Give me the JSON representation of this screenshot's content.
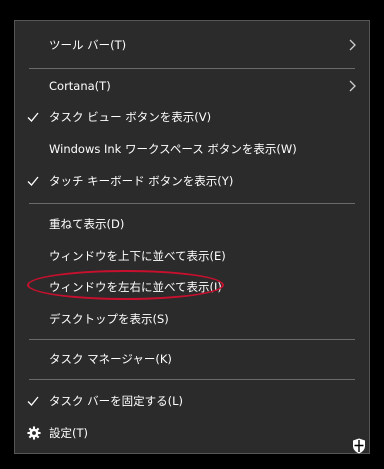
{
  "menu": {
    "items": [
      {
        "label": "ツール バー(T)",
        "checked": false,
        "submenu": true,
        "icon": null
      },
      {
        "label": "Cortana(T)",
        "checked": false,
        "submenu": true,
        "icon": null
      },
      {
        "label": "タスク ビュー ボタンを表示(V)",
        "checked": true,
        "submenu": false,
        "icon": "checkmark-icon"
      },
      {
        "label": "Windows Ink ワークスペース ボタンを表示(W)",
        "checked": false,
        "submenu": false,
        "icon": null
      },
      {
        "label": "タッチ キーボード ボタンを表示(Y)",
        "checked": true,
        "submenu": false,
        "icon": "checkmark-icon"
      },
      {
        "label": "重ねて表示(D)",
        "checked": false,
        "submenu": false,
        "icon": null
      },
      {
        "label": "ウィンドウを上下に並べて表示(E)",
        "checked": false,
        "submenu": false,
        "icon": null
      },
      {
        "label": "ウィンドウを左右に並べて表示(I)",
        "checked": false,
        "submenu": false,
        "icon": null,
        "annotated": true
      },
      {
        "label": "デスクトップを表示(S)",
        "checked": false,
        "submenu": false,
        "icon": null
      },
      {
        "label": "タスク マネージャー(K)",
        "checked": false,
        "submenu": false,
        "icon": null
      },
      {
        "label": "タスク バーを固定する(L)",
        "checked": true,
        "submenu": false,
        "icon": "checkmark-icon"
      },
      {
        "label": "設定(T)",
        "checked": false,
        "submenu": false,
        "icon": "gear-icon"
      }
    ]
  },
  "colors": {
    "menu_background": "#2b2b2b",
    "text": "#ffffff",
    "separator": "#6a6a6a",
    "annotation": "#c8102e"
  },
  "tray": {
    "icon": "shield-icon"
  }
}
